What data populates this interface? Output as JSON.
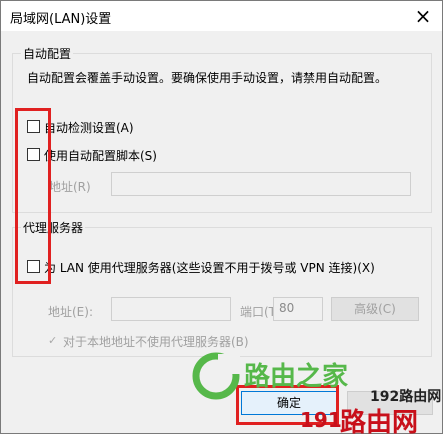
{
  "dialog": {
    "title": "局域网(LAN)设置",
    "close_glyph": "×"
  },
  "auto_config": {
    "group_label": "自动配置",
    "description": "自动配置会覆盖手动设置。要确保使用手动设置，请禁用自动配置。",
    "auto_detect_label": "自动检测设置(A)",
    "auto_detect_checked": false,
    "use_script_label": "使用自动配置脚本(S)",
    "use_script_checked": false,
    "address_label": "地址(R)",
    "address_value": ""
  },
  "proxy": {
    "group_label": "代理服务器",
    "use_proxy_label": "为 LAN 使用代理服务器(这些设置不用于拨号或 VPN 连接)(X)",
    "use_proxy_checked": false,
    "address_label": "地址(E):",
    "address_value": "",
    "port_label": "端口(T):",
    "port_value": "80",
    "advanced_label": "高级(C)",
    "bypass_label": "对于本地地址不使用代理服务器(B)",
    "bypass_checked": true,
    "bypass_check_glyph": "✓"
  },
  "buttons": {
    "ok_label": "确定"
  },
  "watermark": {
    "logo_text": "路由之家",
    "site_text": "192路由网",
    "brand_number": "191",
    "brand_text": "路由网"
  },
  "colors": {
    "highlight": "#e02020",
    "watermark_green": "#56b84a",
    "watermark_red": "#c8101a"
  }
}
